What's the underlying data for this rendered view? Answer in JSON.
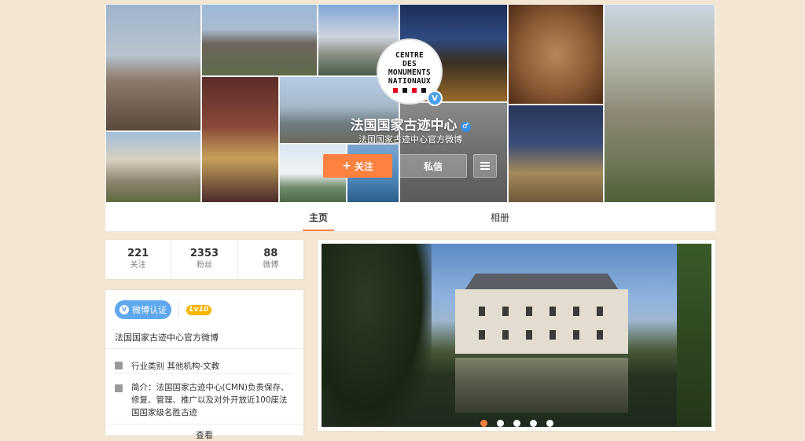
{
  "profile": {
    "name": "法国国家古迹中心",
    "gender_symbol": "♂",
    "subtitle": "法国国家古迹中心官方微博",
    "verified_mark": "V"
  },
  "logo": {
    "lines": [
      "CENTRE",
      "DES",
      "MONUMENTS",
      "NATIONAUX"
    ]
  },
  "actions": {
    "follow_plus": "+",
    "follow_label": "关注",
    "message_label": "私信"
  },
  "tabs": [
    {
      "label": "主页",
      "active": true
    },
    {
      "label": "相册",
      "active": false
    }
  ],
  "stats": [
    {
      "num": "221",
      "label": "关注"
    },
    {
      "num": "2353",
      "label": "粉丝"
    },
    {
      "num": "88",
      "label": "微博"
    }
  ],
  "info": {
    "verify_icon": "V",
    "verify_label": "微博认证",
    "level": "Lv10",
    "official": "法国国家古迹中心官方微博",
    "industry": "行业类别 其他机构-文教",
    "intro": "简介：法国国家古迹中心(CMN)负责保存、修复、管理、推广以及对外开放近100座法国国家级名胜古迹",
    "more": "查看"
  },
  "carousel": {
    "dot_count": 5,
    "active_dot": 1
  },
  "colors": {
    "accent": "#ff8140",
    "verified_blue": "#5fa8ee",
    "level_gold": "#f7b500",
    "page_bg": "#f3e7d3"
  }
}
